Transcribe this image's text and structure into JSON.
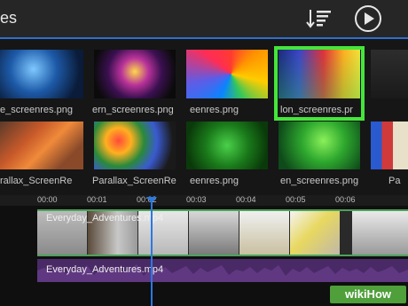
{
  "header": {
    "title": "es",
    "sort_icon": "sort-icon",
    "play_icon": "play-icon"
  },
  "media": {
    "row1": [
      {
        "label": "e_screenres.png"
      },
      {
        "label": "ern_screenres.png"
      },
      {
        "label": "eenres.png"
      },
      {
        "label": "lon_screenres.pr"
      }
    ],
    "row2": [
      {
        "label": "rallax_ScreenRe"
      },
      {
        "label": "Parallax_ScreenRe"
      },
      {
        "label": "eenres.png"
      },
      {
        "label": "en_screenres.png"
      },
      {
        "label": "Pa"
      }
    ]
  },
  "ruler": {
    "ticks": [
      "00:00",
      "00:01",
      "00:02",
      "00:03",
      "00:04",
      "00:05",
      "00:06"
    ]
  },
  "timeline": {
    "video_clip_name": "Everyday_Adventures.mp4",
    "audio_clip_name": "Everyday_Adventures.mp4"
  },
  "watermark": {
    "text": "wikiHow"
  },
  "colors": {
    "accent": "#2e6fd0",
    "selection": "#44e63a",
    "audio": "#4a2a66",
    "playhead": "#2a78e4"
  }
}
